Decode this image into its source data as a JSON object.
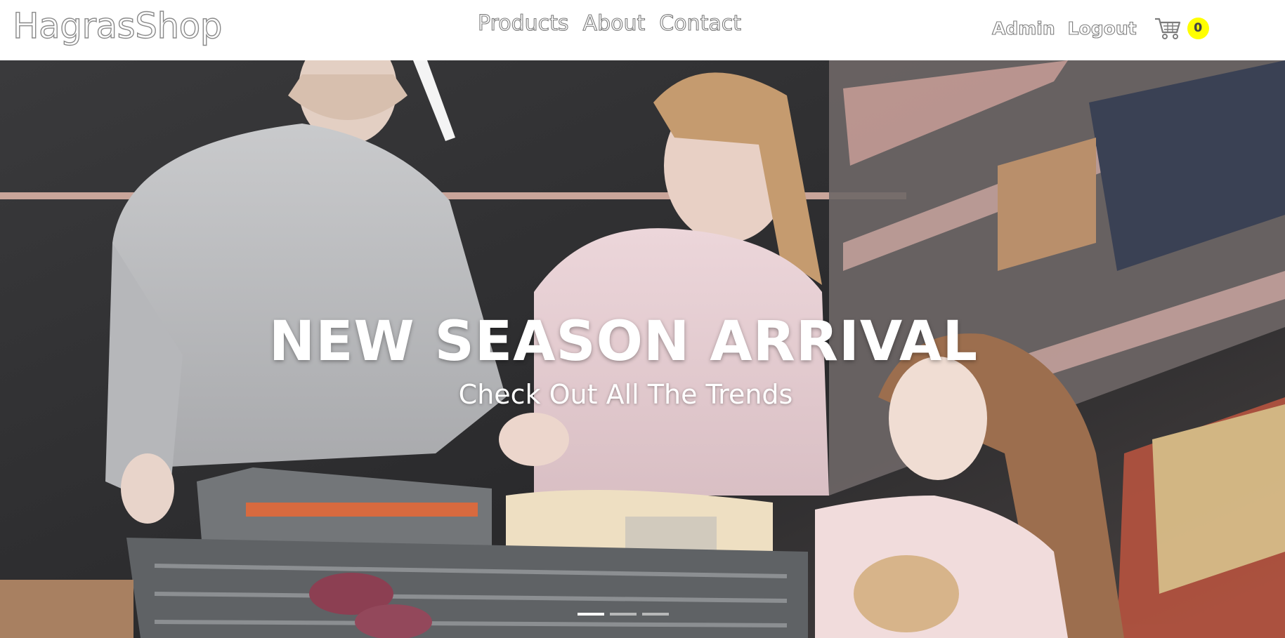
{
  "navbar": {
    "brand": "HagrasShop",
    "links": [
      "Products",
      "About",
      "Contact"
    ],
    "right": {
      "admin": "Admin",
      "logout": "Logout",
      "cart_icon": "cart-icon",
      "cart_count": "0"
    }
  },
  "hero": {
    "title": "NEW SEASON ARRIVAL",
    "subtitle": "Check Out All The Trends",
    "slides": 3,
    "active_slide": 1
  },
  "colors": {
    "navbar_bg": "#ffffff",
    "badge": "#ffff00",
    "hero_text": "#ffffff"
  }
}
